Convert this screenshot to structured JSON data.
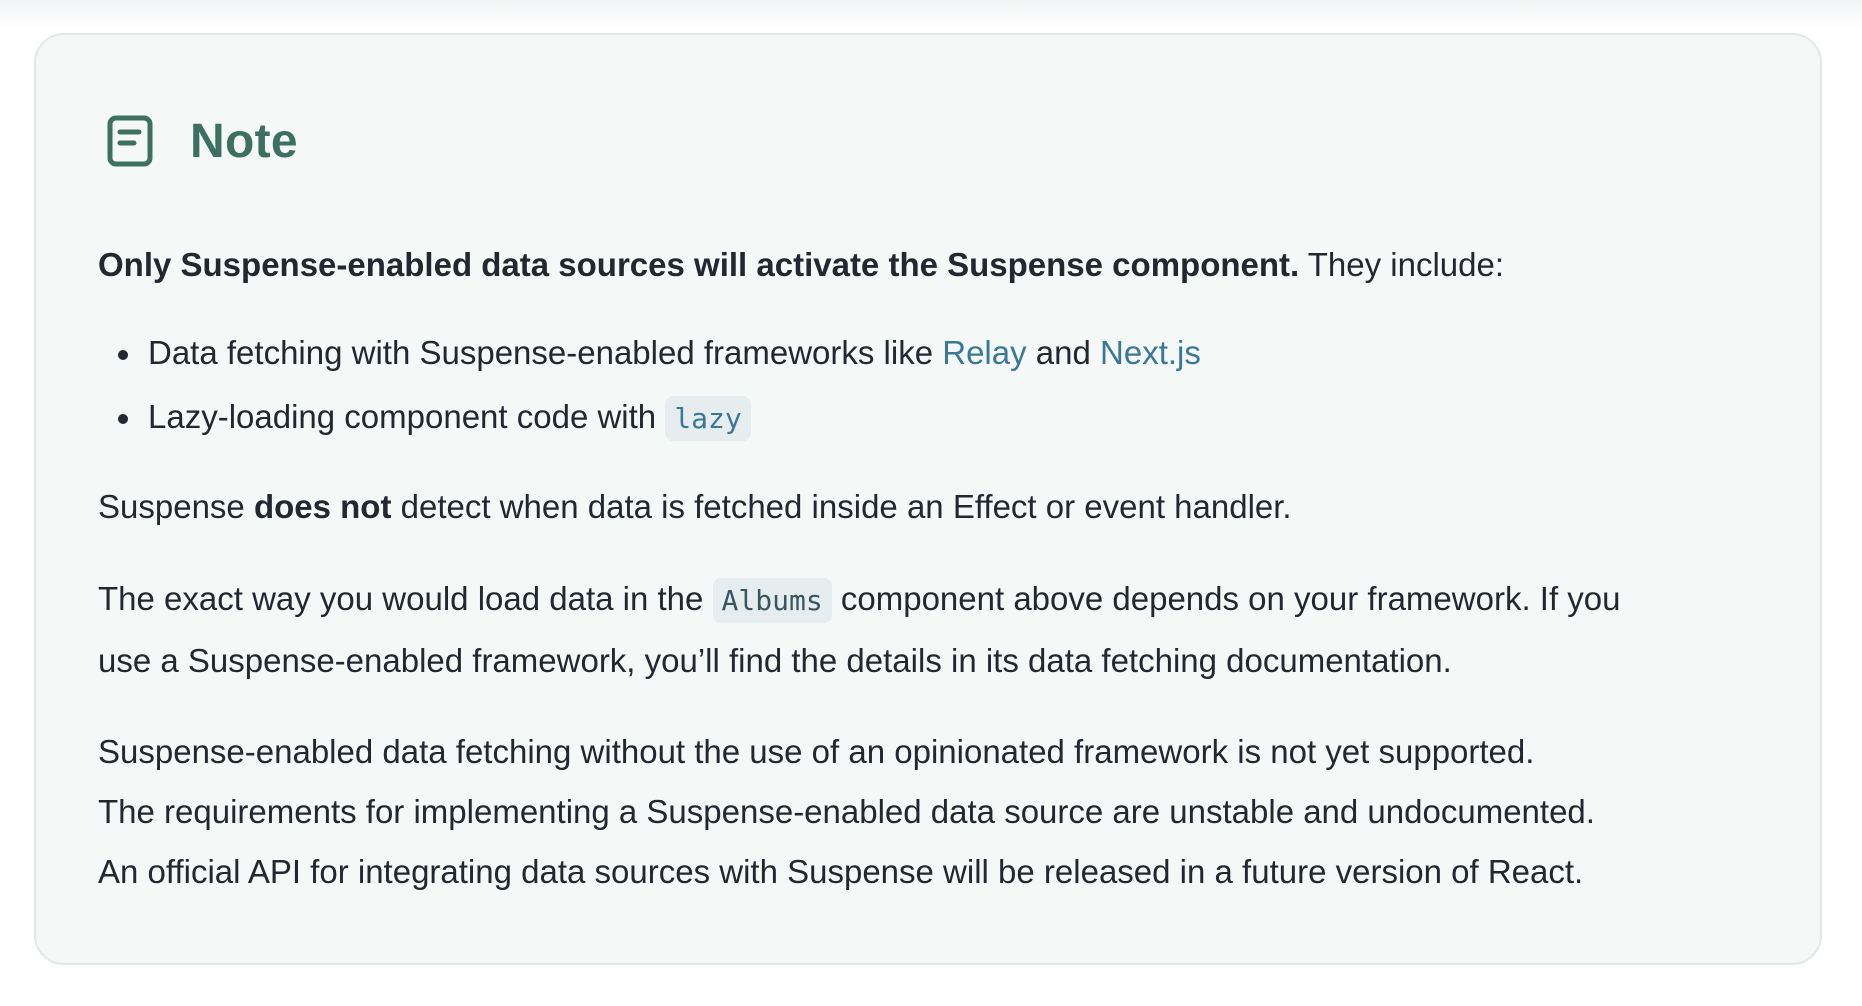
{
  "note": {
    "icon": "note-icon",
    "title": "Note",
    "accent_color": "#3d7060",
    "link_color": "#3b7896"
  },
  "intro": {
    "bold": "Only Suspense-enabled data sources will activate the Suspense component.",
    "rest": " They include:"
  },
  "bullets": [
    {
      "prefix": "Data fetching with Suspense-enabled frameworks like ",
      "link1": "Relay",
      "middle": " and ",
      "link2": "Next.js"
    },
    {
      "prefix": "Lazy-loading component code with ",
      "code": "lazy"
    }
  ],
  "para2": {
    "start": "Suspense ",
    "bold": "does not",
    "end": " detect when data is fetched inside an Effect or event handler."
  },
  "para3": {
    "start": "The exact way you would load data in the ",
    "code": "Albums",
    "line1_end": " component above depends on your framework. If you",
    "line2": "use a Suspense-enabled framework, you’ll find the details in its data fetching documentation."
  },
  "para4": {
    "line1": "Suspense-enabled data fetching without the use of an opinionated framework is not yet supported.",
    "line2": "The requirements for implementing a Suspense-enabled data source are unstable and undocumented.",
    "line3": "An official API for integrating data sources with Suspense will be released in a future version of React."
  }
}
